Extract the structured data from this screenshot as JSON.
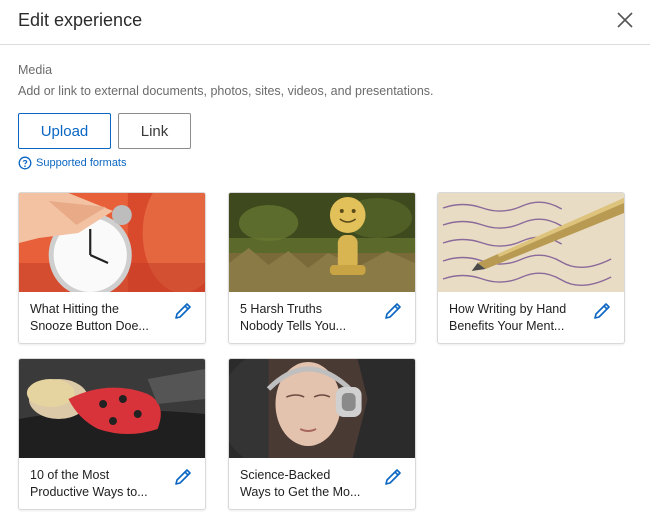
{
  "header": {
    "title": "Edit experience"
  },
  "media": {
    "label": "Media",
    "description": "Add or link to external documents, photos, sites, videos, and presentations.",
    "upload_label": "Upload",
    "link_label": "Link",
    "formats_label": "Supported formats"
  },
  "items": [
    {
      "line1": "What Hitting the",
      "line2": "Snooze Button Doe..."
    },
    {
      "line1": "5 Harsh Truths",
      "line2": "Nobody Tells You..."
    },
    {
      "line1": "How Writing by Hand",
      "line2": "Benefits Your Ment..."
    },
    {
      "line1": "10 of the Most",
      "line2": "Productive Ways to..."
    },
    {
      "line1": "Science-Backed",
      "line2": "Ways to Get the Mo..."
    }
  ],
  "colors": {
    "accent": "#0a66c2",
    "border": "#d9d9d9"
  }
}
